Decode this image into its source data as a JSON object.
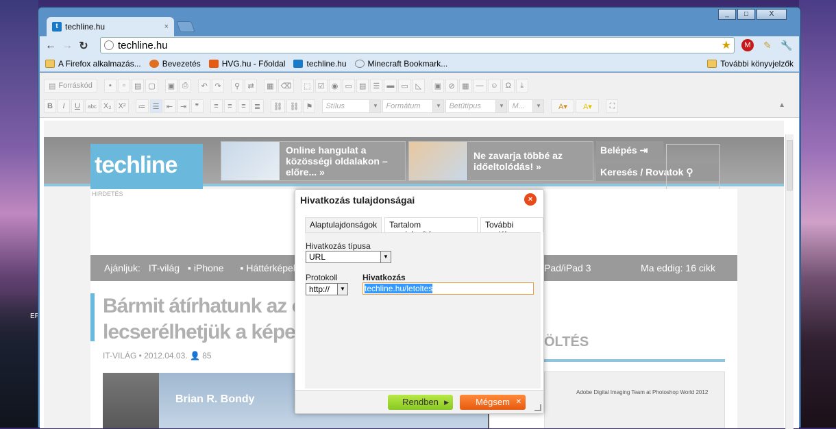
{
  "desktop": {
    "left_text": "EF"
  },
  "window": {
    "controls": [
      "_",
      "□",
      "X"
    ]
  },
  "tab": {
    "title": "techline.hu",
    "fav": "t",
    "close": "×"
  },
  "toolbar": {
    "back": "←",
    "forward": "→",
    "reload": "↻",
    "url": "techline.hu",
    "star": "★"
  },
  "bookmarks": [
    {
      "label": "A Firefox alkalmazás...",
      "icon": "folder-icon"
    },
    {
      "label": "Bevezetés",
      "icon": "firefox-icon"
    },
    {
      "label": "HVG.hu - Főoldal",
      "icon": "hvg-icon"
    },
    {
      "label": "techline.hu",
      "icon": "techline-icon"
    },
    {
      "label": "Minecraft Bookmark...",
      "icon": "globe-icon"
    }
  ],
  "bookmarks_other": "További könyvjelzők",
  "editor": {
    "source_label": "Forráskód",
    "row2": [
      "B",
      "I",
      "U",
      "abc",
      "X₂",
      "X²"
    ],
    "combos": [
      "Stílus",
      "Formátum",
      "Betűtípus",
      "M..."
    ]
  },
  "site": {
    "logo": "techline",
    "promo1": "Online hangulat a közösségi oldalakon – előre... »",
    "promo2": "Ne zavarja többé az időeltolódás! »",
    "login": "Belépés",
    "search": "Keresés / Rovatok",
    "ad_label": "HIRDETÉS",
    "nav_prefix": "Ajánljuk:",
    "nav_items": [
      "IT-világ",
      "iPhone",
      "Háttérképek"
    ],
    "nav_mid": "Pad/iPad 3",
    "nav_right": "Ma eddig: 16 cikk",
    "article_title_1": "Bármit átírhatunk az ol",
    "article_title_2": "lecserélhetjük a képeke",
    "article_meta": "IT-VILÁG • 2012.04.03.  👤 85",
    "shot_name": "Brian R. Bondy",
    "side_heading": "ÖLTÉS",
    "side_shot_text": "Adobe Digital Imaging Team at Photoshop World 2012"
  },
  "dialog": {
    "title": "Hivatkozás tulajdonságai",
    "tabs": [
      "Alaptulajdonságok",
      "Tartalom megjelenítése",
      "További opciók"
    ],
    "type_label": "Hivatkozás típusa",
    "type_value": "URL",
    "protocol_label": "Protokoll",
    "protocol_value": "http://",
    "link_label": "Hivatkozás",
    "link_value": "techline.hu/letoltes",
    "ok": "Rendben",
    "cancel": "Mégsem"
  }
}
